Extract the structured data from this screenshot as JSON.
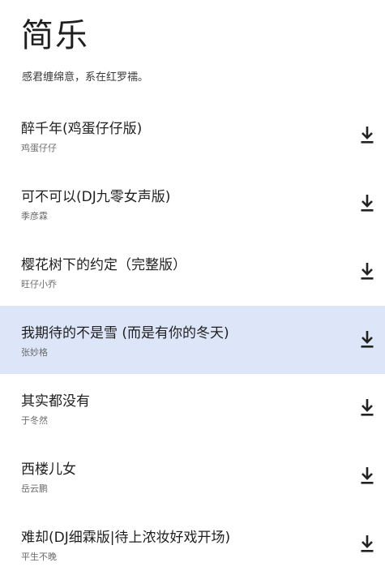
{
  "app": {
    "title": "简乐",
    "subtitle": "感君缠绵意，系在红罗襦。"
  },
  "songs": [
    {
      "title": "醉千年(鸡蛋仔仔版)",
      "artist": "鸡蛋仔仔",
      "selected": false
    },
    {
      "title": "可不可以(DJ九零女声版)",
      "artist": "季彦霖",
      "selected": false
    },
    {
      "title": "樱花树下的约定（完整版）",
      "artist": "旺仔小乔",
      "selected": false
    },
    {
      "title": "我期待的不是雪 (而是有你的冬天)",
      "artist": "张妙格",
      "selected": true
    },
    {
      "title": "其实都没有",
      "artist": "于冬然",
      "selected": false
    },
    {
      "title": "西楼儿女",
      "artist": "岳云鹏",
      "selected": false
    },
    {
      "title": "难却(DJ细霖版|待上浓妆好戏开场)",
      "artist": "平生不晚",
      "selected": false
    }
  ],
  "icons": {
    "download": "download-icon"
  },
  "colors": {
    "selected_background": "#dde5f8",
    "icon": "#222222"
  }
}
